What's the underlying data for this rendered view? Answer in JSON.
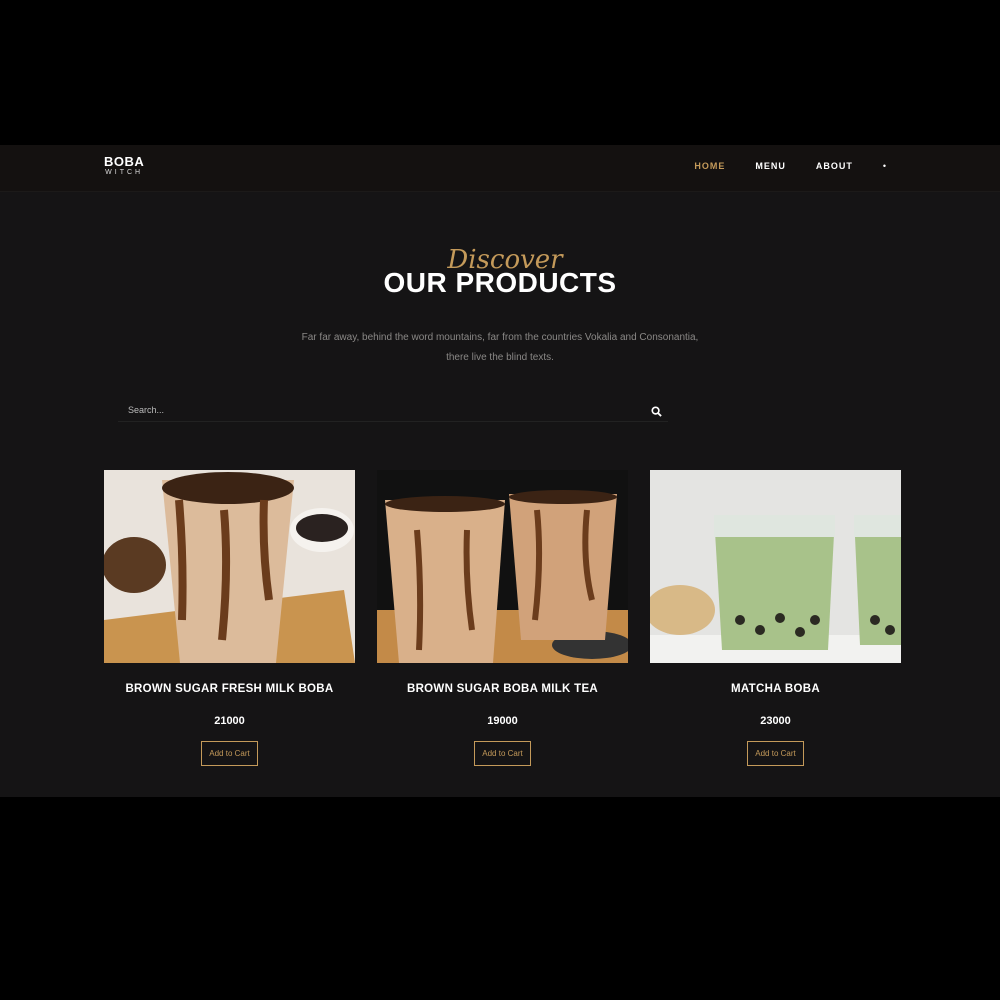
{
  "brand": {
    "line1": "BOBA",
    "line2": "WITCH"
  },
  "nav": {
    "items": [
      {
        "label": "HOME",
        "active": true
      },
      {
        "label": "MENU"
      },
      {
        "label": "ABOUT"
      }
    ],
    "extra": "•"
  },
  "hero": {
    "script": "Discover",
    "title": "OUR PRODUCTS",
    "description": "Far far away, behind the word mountains, far from the countries Vokalia and Consonantia, there live the blind texts."
  },
  "search": {
    "placeholder": "Search...",
    "icon": "search-icon"
  },
  "colors": {
    "accent": "#c49a5a",
    "background": "#151415",
    "nav": "#141110"
  },
  "products": [
    {
      "name": "BROWN SUGAR FRESH MILK BOBA",
      "price": "21000",
      "button": "Add to Cart"
    },
    {
      "name": "BROWN SUGAR BOBA MILK TEA",
      "price": "19000",
      "button": "Add to Cart"
    },
    {
      "name": "MATCHA BOBA",
      "price": "23000",
      "button": "Add to Cart"
    }
  ]
}
